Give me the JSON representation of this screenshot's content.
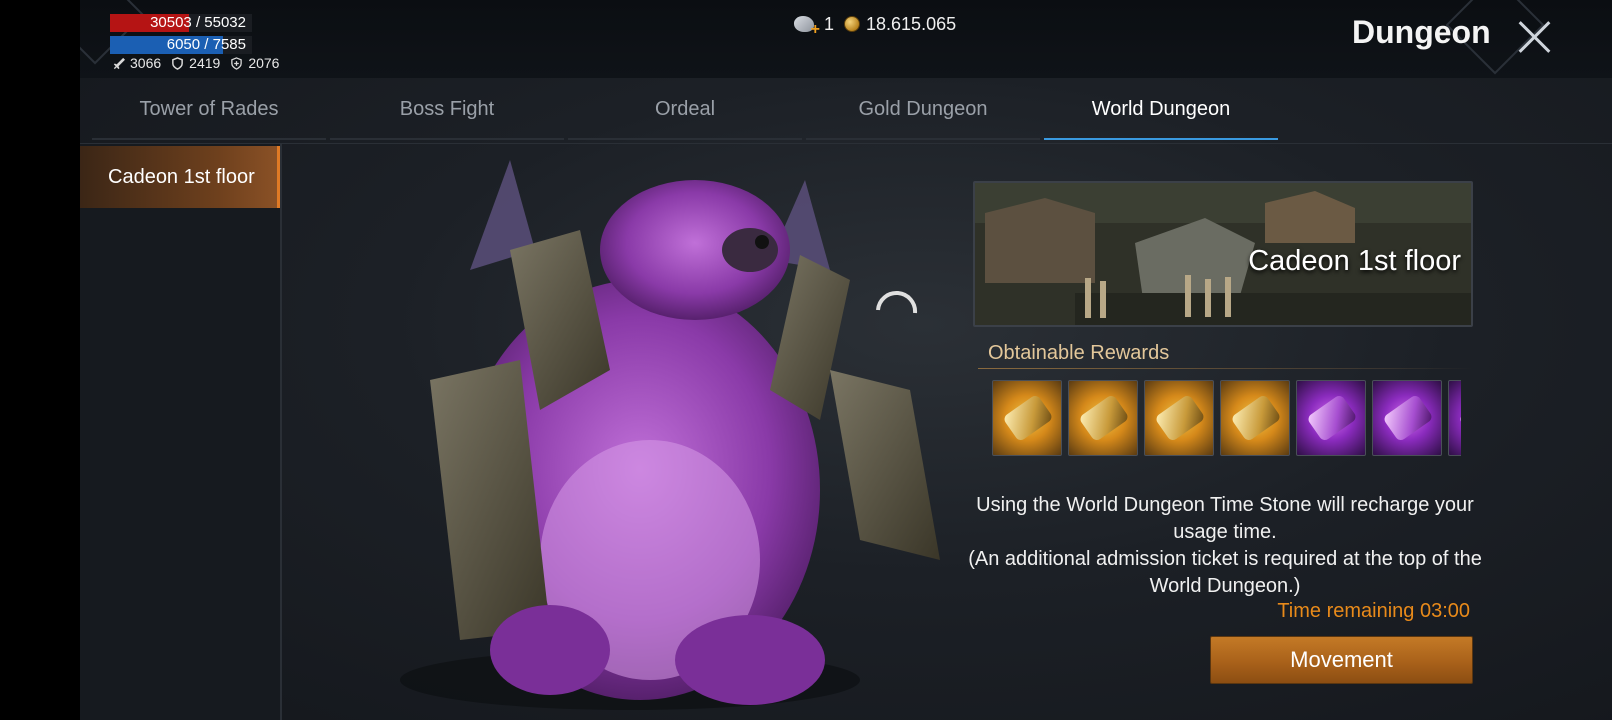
{
  "player": {
    "hp_text": "30503 / 55032",
    "hp_fraction": 0.554,
    "mp_text": "6050 / 7585",
    "mp_fraction": 0.798,
    "attack": "3066",
    "defense": "2419",
    "resistance": "2076",
    "icons": {
      "attack": "sword-icon",
      "defense": "shield-icon",
      "resistance": "shield-plus-icon"
    }
  },
  "currency": {
    "time_stone_count": "1",
    "gold": "18.615.065",
    "icons": {
      "time_stone": "time-stone-icon",
      "gold": "gold-coin-icon"
    }
  },
  "header": {
    "title": "Dungeon",
    "close_icon": "close-icon"
  },
  "tabs": [
    {
      "label": "Tower of Rades",
      "active": false
    },
    {
      "label": "Boss Fight",
      "active": false
    },
    {
      "label": "Ordeal",
      "active": false
    },
    {
      "label": "Gold Dungeon",
      "active": false
    },
    {
      "label": "World Dungeon",
      "active": true
    }
  ],
  "sidebar": {
    "items": [
      {
        "label": "Cadeon 1st floor",
        "selected": true
      }
    ]
  },
  "main": {
    "banner_title": "Cadeon 1st floor",
    "rewards_label": "Obtainable Rewards",
    "rewards": [
      {
        "name": "gold-scroll-icon",
        "rarity": "gold"
      },
      {
        "name": "gold-scroll-icon",
        "rarity": "gold"
      },
      {
        "name": "gold-scroll-icon",
        "rarity": "gold"
      },
      {
        "name": "gold-scroll-icon",
        "rarity": "gold"
      },
      {
        "name": "purple-scroll-icon",
        "rarity": "purple"
      },
      {
        "name": "purple-scroll-icon",
        "rarity": "purple"
      },
      {
        "name": "purple-scroll-icon",
        "rarity": "purple"
      }
    ],
    "description_line1": "Using the World Dungeon Time Stone will recharge your usage time.",
    "description_line2": "(An additional admission ticket is required at the top of the World Dungeon.)",
    "time_remaining": "Time remaining 03:00",
    "movement_button": "Movement"
  },
  "colors": {
    "accent_orange": "#e07a25",
    "tab_active_underline": "#3a9ae0",
    "time_text": "#e88a1a",
    "hp": "#b51414",
    "mp": "#1b5fb3"
  }
}
